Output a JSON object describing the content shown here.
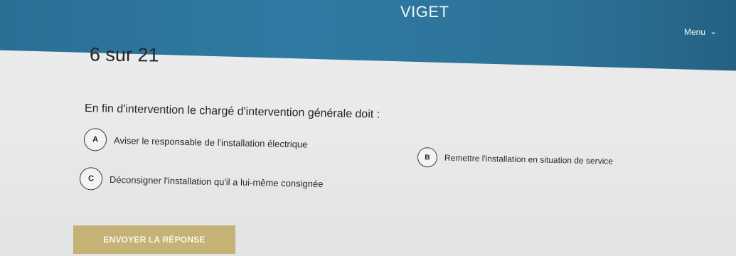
{
  "header": {
    "brand": "VIGET",
    "menu_label": "Menu",
    "menu_icon": "chevron-down-icon"
  },
  "quiz": {
    "counter": "6 sur 21",
    "question": "En fin d'intervention le chargé d'intervention générale doit :",
    "answers": [
      {
        "letter": "A",
        "text": "Aviser le responsable de l'installation électrique"
      },
      {
        "letter": "B",
        "text": "Remettre l'installation en situation de service"
      },
      {
        "letter": "C",
        "text": "Déconsigner l'installation qu'il a lui-même consignée"
      }
    ],
    "submit_label": "ENVOYER LA RÉPONSE"
  },
  "colors": {
    "header_bg": "#2f7aa3",
    "submit_bg": "#c4b277",
    "page_bg": "#e9eaea"
  }
}
